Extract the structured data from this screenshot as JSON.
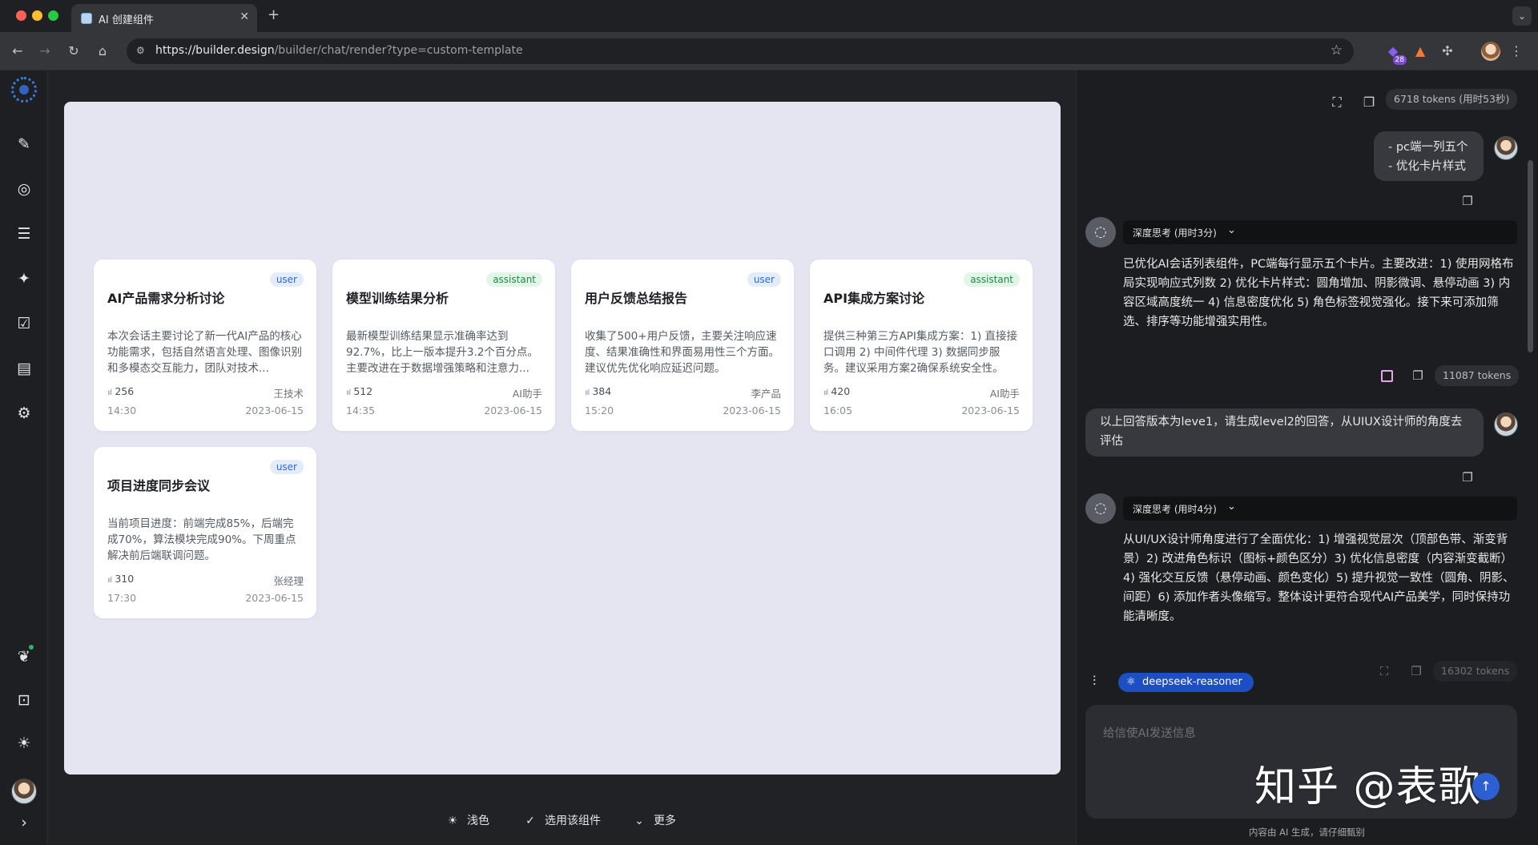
{
  "browser": {
    "tab_title": "AI 创建组件",
    "url_host": "https://builder.design",
    "url_path": "/builder/chat/render?type=custom-template",
    "extension_badge": "28"
  },
  "preview": {
    "cards": [
      {
        "badge": "user",
        "title": "AI产品需求分析讨论",
        "desc": "本次会话主要讨论了新一代AI产品的核心功能需求，包括自然语言处理、图像识别和多模态交互能力，团队对技术...",
        "count": "256",
        "author": "王技术",
        "time": "14:30",
        "date": "2023-06-15"
      },
      {
        "badge": "assistant",
        "title": "模型训练结果分析",
        "desc": "最新模型训练结果显示准确率达到92.7%，比上一版本提升3.2个百分点。主要改进在于数据增强策略和注意力...",
        "count": "512",
        "author": "AI助手",
        "time": "14:35",
        "date": "2023-06-15"
      },
      {
        "badge": "user",
        "title": "用户反馈总结报告",
        "desc": "收集了500+用户反馈，主要关注响应速度、结果准确性和界面易用性三个方面。建议优先优化响应延迟问题。",
        "count": "384",
        "author": "李产品",
        "time": "15:20",
        "date": "2023-06-15"
      },
      {
        "badge": "assistant",
        "title": "API集成方案讨论",
        "desc": "提供三种第三方API集成方案：1) 直接接口调用 2) 中间件代理 3) 数据同步服务。建议采用方案2确保系统安全性。",
        "count": "420",
        "author": "AI助手",
        "time": "16:05",
        "date": "2023-06-15"
      },
      {
        "badge": "user",
        "title": "项目进度同步会议",
        "desc": "当前项目进度：前端完成85%，后端完成70%，算法模块完成90%。下周重点解决前后端联调问题。",
        "count": "310",
        "author": "张经理",
        "time": "17:30",
        "date": "2023-06-15"
      }
    ],
    "actions": {
      "theme": "浅色",
      "select": "选用该组件",
      "more": "更多"
    }
  },
  "chat": {
    "header_tokens": "6718 tokens (用时53秒)",
    "user_msg_1_line1": "- pc端一列五个",
    "user_msg_1_line2": "- 优化卡片样式",
    "think_1": "深度思考 (用时3分)",
    "ai_msg_1": "已优化AI会话列表组件，PC端每行显示五个卡片。主要改进：1) 使用网格布局实现响应式列数 2) 优化卡片样式：圆角增加、阴影微调、悬停动画 3) 内容区域高度统一 4) 信息密度优化 5) 角色标签视觉强化。接下来可添加筛选、排序等功能增强实用性。",
    "tokens_1": "11087 tokens",
    "user_msg_2": "以上回答版本为leve1，请生成level2的回答，从UIUX设计师的角度去评估",
    "think_2": "深度思考 (用时4分)",
    "ai_msg_2": "从UI/UX设计师角度进行了全面优化：1) 增强视觉层次（顶部色带、渐变背景）2) 改进角色标识（图标+颜色区分）3) 优化信息密度（内容渐变截断）4) 强化交互反馈（悬停动画、颜色变化）5) 提升视觉一致性（圆角、阴影、间距）6) 添加作者头像缩写。整体设计更符合现代AI产品美学，同时保持功能清晰度。",
    "tokens_2": "16302 tokens",
    "model": "deepseek-reasoner",
    "input_placeholder": "给信使AI发送信息",
    "disclaimer": "内容由 AI 生成，请仔细甄别"
  },
  "watermark": "知乎 @表歌"
}
